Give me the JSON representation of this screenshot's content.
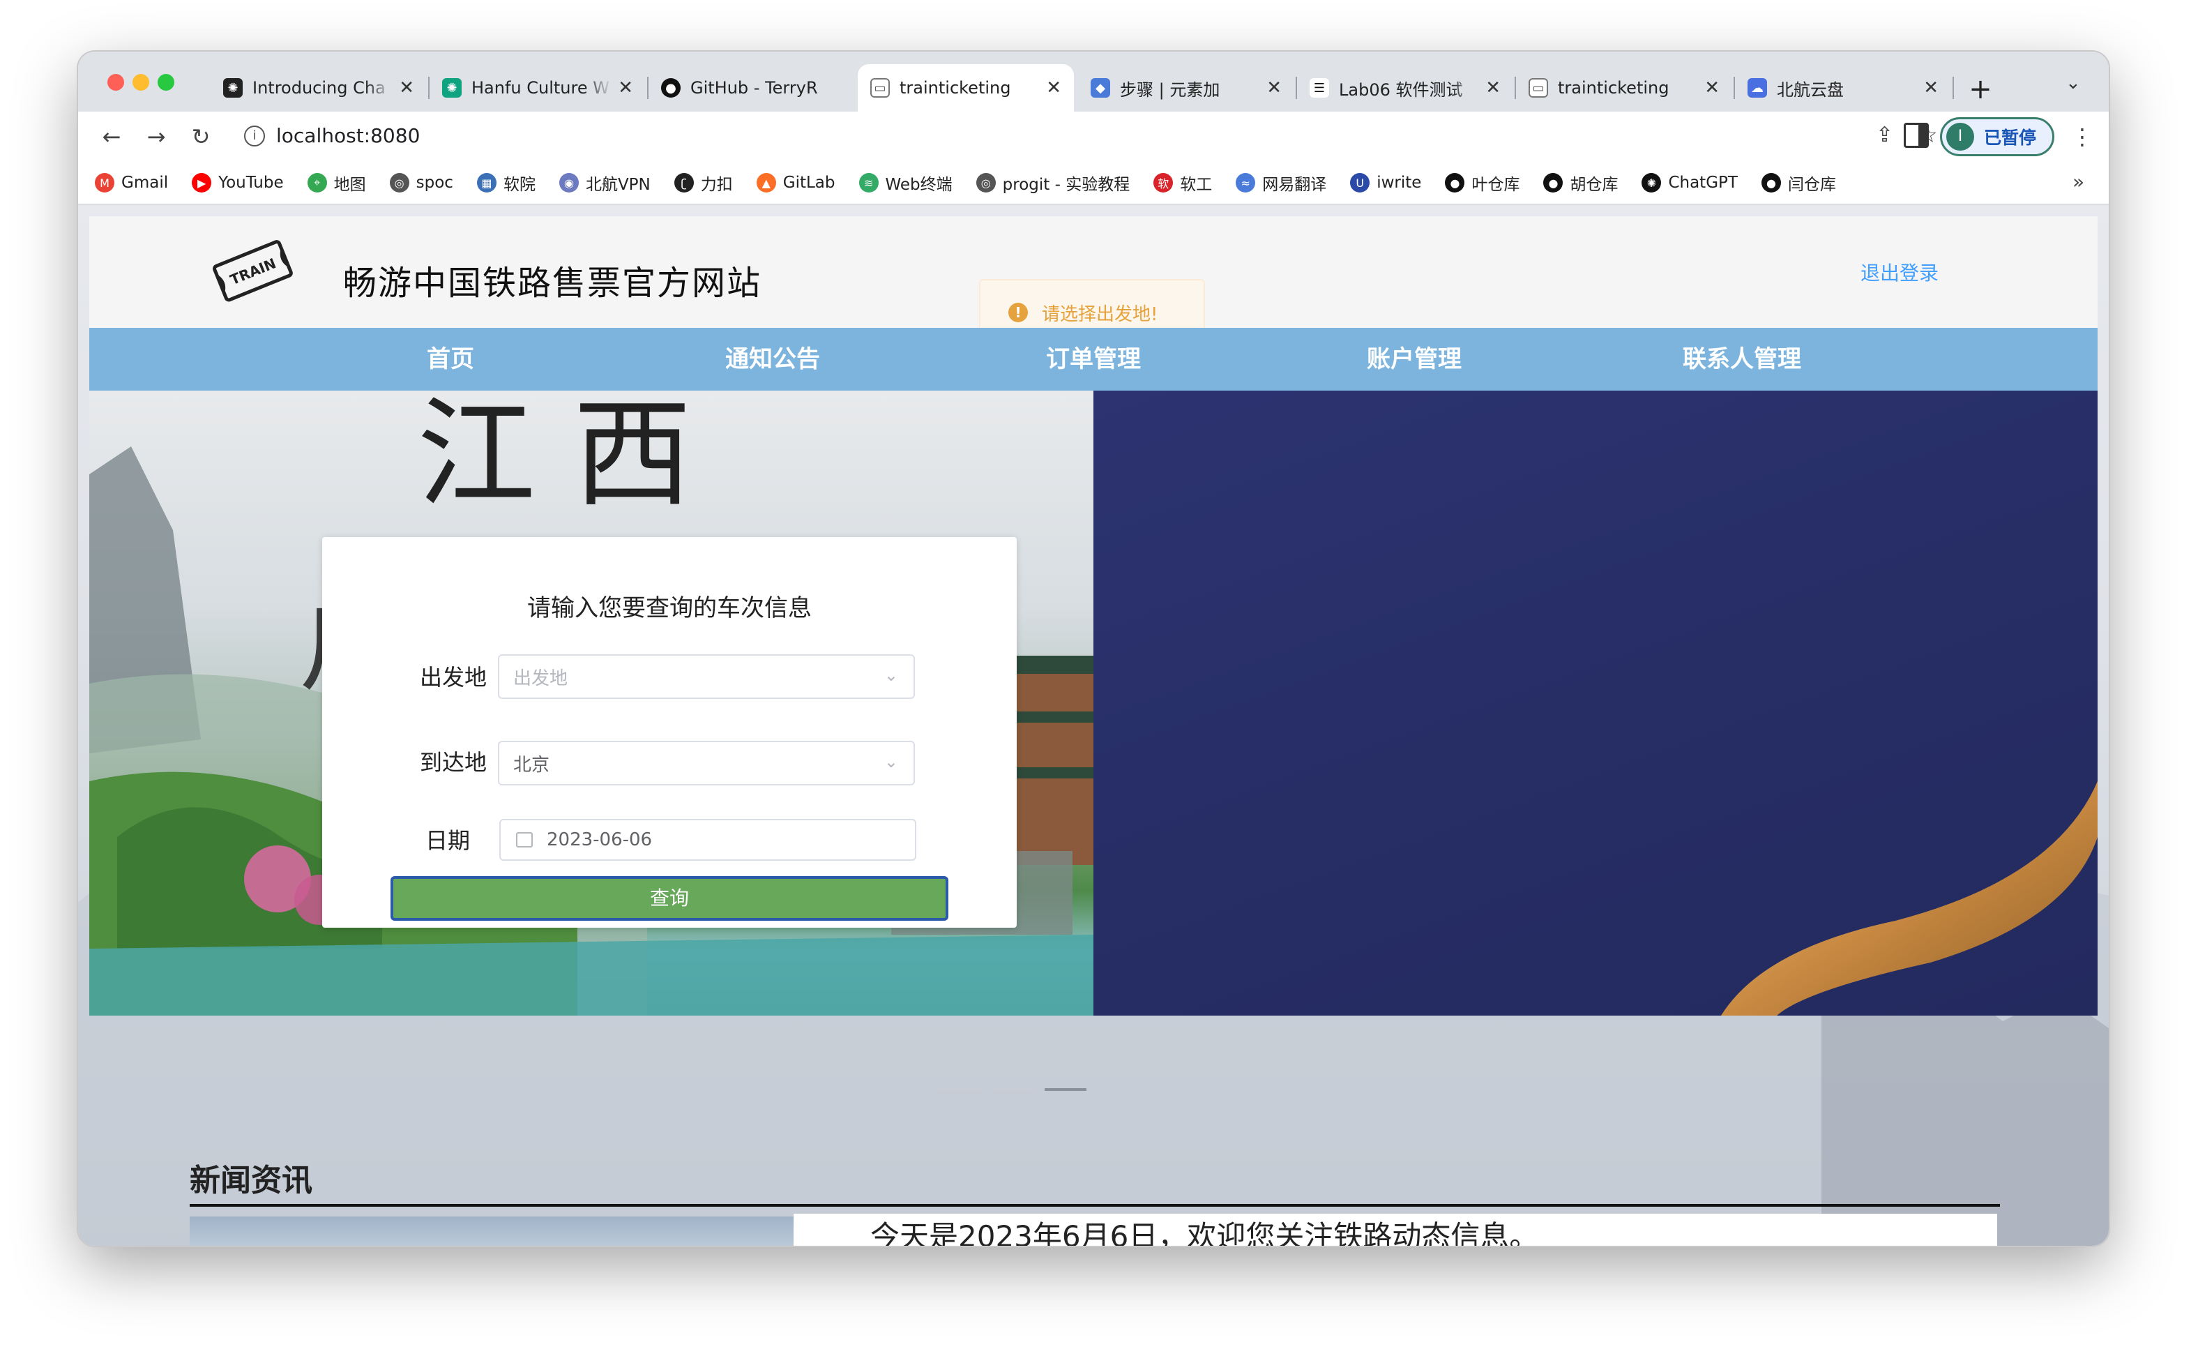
{
  "browser": {
    "tabs": [
      {
        "title": "Introducing Cha",
        "icon": "openai-icon"
      },
      {
        "title": "Hanfu Culture W",
        "icon": "chatgpt-icon"
      },
      {
        "title": "GitHub - TerryR",
        "icon": "github-icon"
      },
      {
        "title": "trainticketing",
        "icon": "page-icon",
        "active": true
      },
      {
        "title": "步骤 | 元素加",
        "icon": "yuansujia-icon"
      },
      {
        "title": "Lab06 软件测试",
        "icon": "doc-icon"
      },
      {
        "title": "trainticketing",
        "icon": "page-icon"
      },
      {
        "title": "北航云盘",
        "icon": "pan-icon"
      }
    ],
    "new_tab_label": "+",
    "address": "localhost:8080",
    "profile_label": "已暂停",
    "profile_initial": "I",
    "bookmarks": [
      {
        "label": "Gmail",
        "icon": "gmail-icon",
        "color": "#ea4335"
      },
      {
        "label": "YouTube",
        "icon": "youtube-icon",
        "color": "#ff0000"
      },
      {
        "label": "地图",
        "icon": "maps-icon",
        "color": "#34a853"
      },
      {
        "label": "spoc",
        "icon": "globe-icon",
        "color": "#555555"
      },
      {
        "label": "软院",
        "icon": "school-icon",
        "color": "#3b6fb6"
      },
      {
        "label": "北航VPN",
        "icon": "vpn-icon",
        "color": "#6c7bbf"
      },
      {
        "label": "力扣",
        "icon": "leetcode-icon",
        "color": "#222222"
      },
      {
        "label": "GitLab",
        "icon": "gitlab-icon",
        "color": "#fc6d26"
      },
      {
        "label": "Web终端",
        "icon": "terminal-icon",
        "color": "#33aa66"
      },
      {
        "label": "progit - 实验教程",
        "icon": "globe-icon",
        "color": "#555555"
      },
      {
        "label": "软工",
        "icon": "ruangong-icon",
        "color": "#d8232a"
      },
      {
        "label": "网易翻译",
        "icon": "translate-icon",
        "color": "#4a7bd8"
      },
      {
        "label": "iwrite",
        "icon": "iwrite-icon",
        "color": "#2b4aa8"
      },
      {
        "label": "叶仓库",
        "icon": "github-icon",
        "color": "#111111"
      },
      {
        "label": "胡仓库",
        "icon": "github-icon",
        "color": "#111111"
      },
      {
        "label": "ChatGPT",
        "icon": "openai-icon",
        "color": "#111111"
      },
      {
        "label": "闫仓库",
        "icon": "github-icon",
        "color": "#111111"
      }
    ],
    "more_bookmarks": "»"
  },
  "site": {
    "logo_text": "TRAIN",
    "title": "畅游中国铁路售票官方网站",
    "logout": "退出登录",
    "nav": [
      "首页",
      "通知公告",
      "订单管理",
      "账户管理",
      "联系人管理"
    ],
    "toast": "请选择出发地!",
    "banner_text": "江 西"
  },
  "search": {
    "heading": "请输入您要查询的车次信息",
    "from_label": "出发地",
    "from_placeholder": "出发地",
    "to_label": "到达地",
    "to_value": "北京",
    "date_label": "日期",
    "date_value": "2023-06-06",
    "submit": "查询"
  },
  "carousel": {
    "count": 3,
    "active": 3
  },
  "news": {
    "title": "新闻资讯",
    "headline": "今天是2023年6月6日，欢迎您关注铁路动态信息。"
  },
  "colors": {
    "nav_bg": "#7cb4dd",
    "button_green": "#67a85a",
    "button_border": "#2b5aa8",
    "link_blue": "#409eff",
    "warning": "#e6a23c"
  }
}
